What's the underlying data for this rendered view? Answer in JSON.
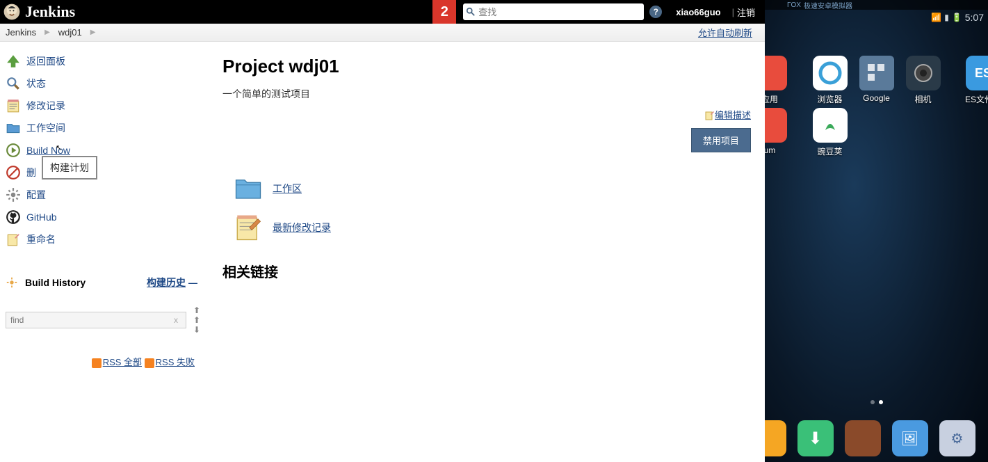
{
  "header": {
    "logo_text": "Jenkins",
    "notif_count": "2",
    "search_placeholder": "查找",
    "user": "xiao66guo",
    "logout": "注销",
    "sep": "|"
  },
  "crumb": {
    "root": "Jenkins",
    "proj": "wdj01",
    "autorefresh": "允许自动刷新"
  },
  "side": {
    "back": "返回面板",
    "status": "状态",
    "changes": "修改记录",
    "ws": "工作空间",
    "build_now": "Build Now",
    "build_tooltip": "构建计划",
    "delete": "删",
    "config": "配置",
    "github": "GitHub",
    "rename": "重命名"
  },
  "bh": {
    "title": "Build History",
    "link": "构建历史",
    "trend": "—",
    "find_placeholder": "find",
    "rss_all": "RSS 全部",
    "rss_fail": "RSS 失败"
  },
  "main": {
    "title": "Project wdj01",
    "desc": "一个简单的测试项目",
    "edit_desc": "编辑描述",
    "disable": "禁用项目",
    "workspace": "工作区",
    "recent": "最新修改记录",
    "related": "相关链接"
  },
  "android": {
    "time": "5:07",
    "top_text": "极速安卓模拟器",
    "icons": {
      "app": "应用",
      "browser": "浏览器",
      "google": "Google",
      "camera": "相机",
      "es": "ES文件浏",
      "um": "um",
      "wandou": "豌豆荚"
    }
  }
}
